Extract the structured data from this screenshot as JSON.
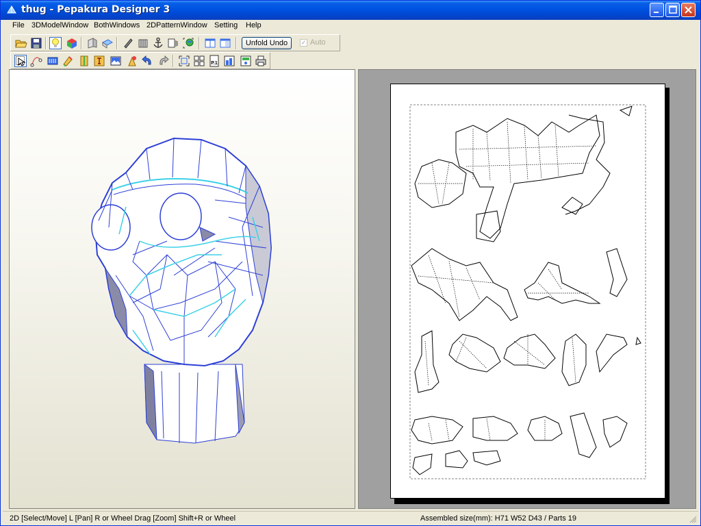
{
  "window": {
    "title": "thug - Pepakura Designer 3"
  },
  "menu": {
    "items": [
      "File",
      "3DModelWindow",
      "BothWindows",
      "2DPatternWindow",
      "Setting",
      "Help"
    ]
  },
  "toolbar1": {
    "unfold_undo_label": "Unfold Undo",
    "auto_label": "Auto",
    "auto_checked": true,
    "auto_enabled": false,
    "icons": [
      "open-icon",
      "save-icon",
      "light-icon",
      "texture-icon",
      "fold-left-icon",
      "fold-right-icon",
      "edit-icon",
      "fold-cube-icon",
      "anchor-icon",
      "split-view-icon",
      "globe-icon",
      "window-left-icon",
      "window-right-icon"
    ]
  },
  "toolbar2": {
    "icons": [
      "select-move-icon",
      "edge-icon",
      "flap-icon",
      "paint-icon",
      "join-icon",
      "text-icon",
      "image-icon",
      "rotate-icon",
      "undo-icon",
      "redo-icon",
      "fit-icon",
      "arrange-icon",
      "page-icon",
      "page-layout-icon",
      "print-settings-icon",
      "print-icon"
    ],
    "page_icon_text": "P.1"
  },
  "view3d": {
    "name": "3D model view",
    "colors": {
      "edge": "#2c3fd6",
      "fold": "#3bd1e8",
      "face": "#ffffff"
    }
  },
  "view2d": {
    "name": "2D pattern view"
  },
  "status": {
    "hint": "2D [Select/Move] L [Pan] R or Wheel Drag [Zoom] Shift+R or Wheel",
    "assembled": "Assembled size(mm): H71 W52 D43 / Parts 19"
  }
}
